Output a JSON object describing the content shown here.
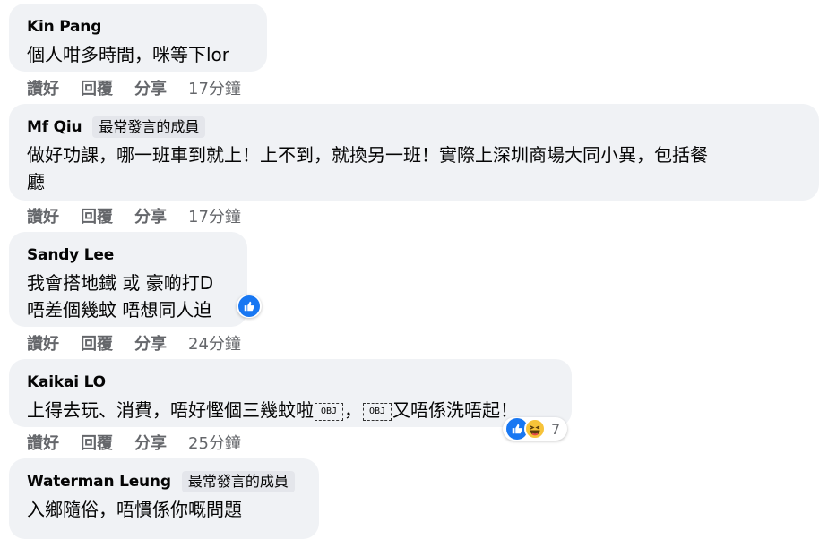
{
  "comments": [
    {
      "author": "Kin Pang",
      "badge": "",
      "text": "個人咁多時間，咪等下lor",
      "actions": {
        "like": "讚好",
        "reply": "回覆",
        "share": "分享",
        "time": "17分鐘"
      }
    },
    {
      "author": "Mf Qiu",
      "badge": "最常發言的成員",
      "line1": "做好功課，哪一班車到就上！上不到，就換另一班！實際上深圳商場大同小異，包括餐",
      "line2": "廳",
      "actions": {
        "like": "讚好",
        "reply": "回覆",
        "share": "分享",
        "time": "17分鐘"
      }
    },
    {
      "author": "Sandy Lee",
      "badge": "",
      "line1": "我會搭地鐵 或 豪啲打D",
      "line2": "唔差個幾蚊 唔想同人迫",
      "actions": {
        "like": "讚好",
        "reply": "回覆",
        "share": "分享",
        "time": "24分鐘"
      }
    },
    {
      "author": "Kaikai LO",
      "badge": "",
      "text_a": "上得去玩、消費，唔好慳個三幾蚊啦",
      "text_b": "，",
      "text_c": "又唔係洗唔起！",
      "obj_label": "OBJ",
      "reaction_count": "7",
      "actions": {
        "like": "讚好",
        "reply": "回覆",
        "share": "分享",
        "time": "25分鐘"
      }
    },
    {
      "author": "Waterman Leung",
      "badge": "最常發言的成員",
      "text": "入鄉隨俗，唔慣係你嘅問題"
    }
  ],
  "colors": {
    "bubble": "#f0f2f5",
    "like": "#1877f2",
    "haha": "#f7c339",
    "meta": "#65676b"
  }
}
